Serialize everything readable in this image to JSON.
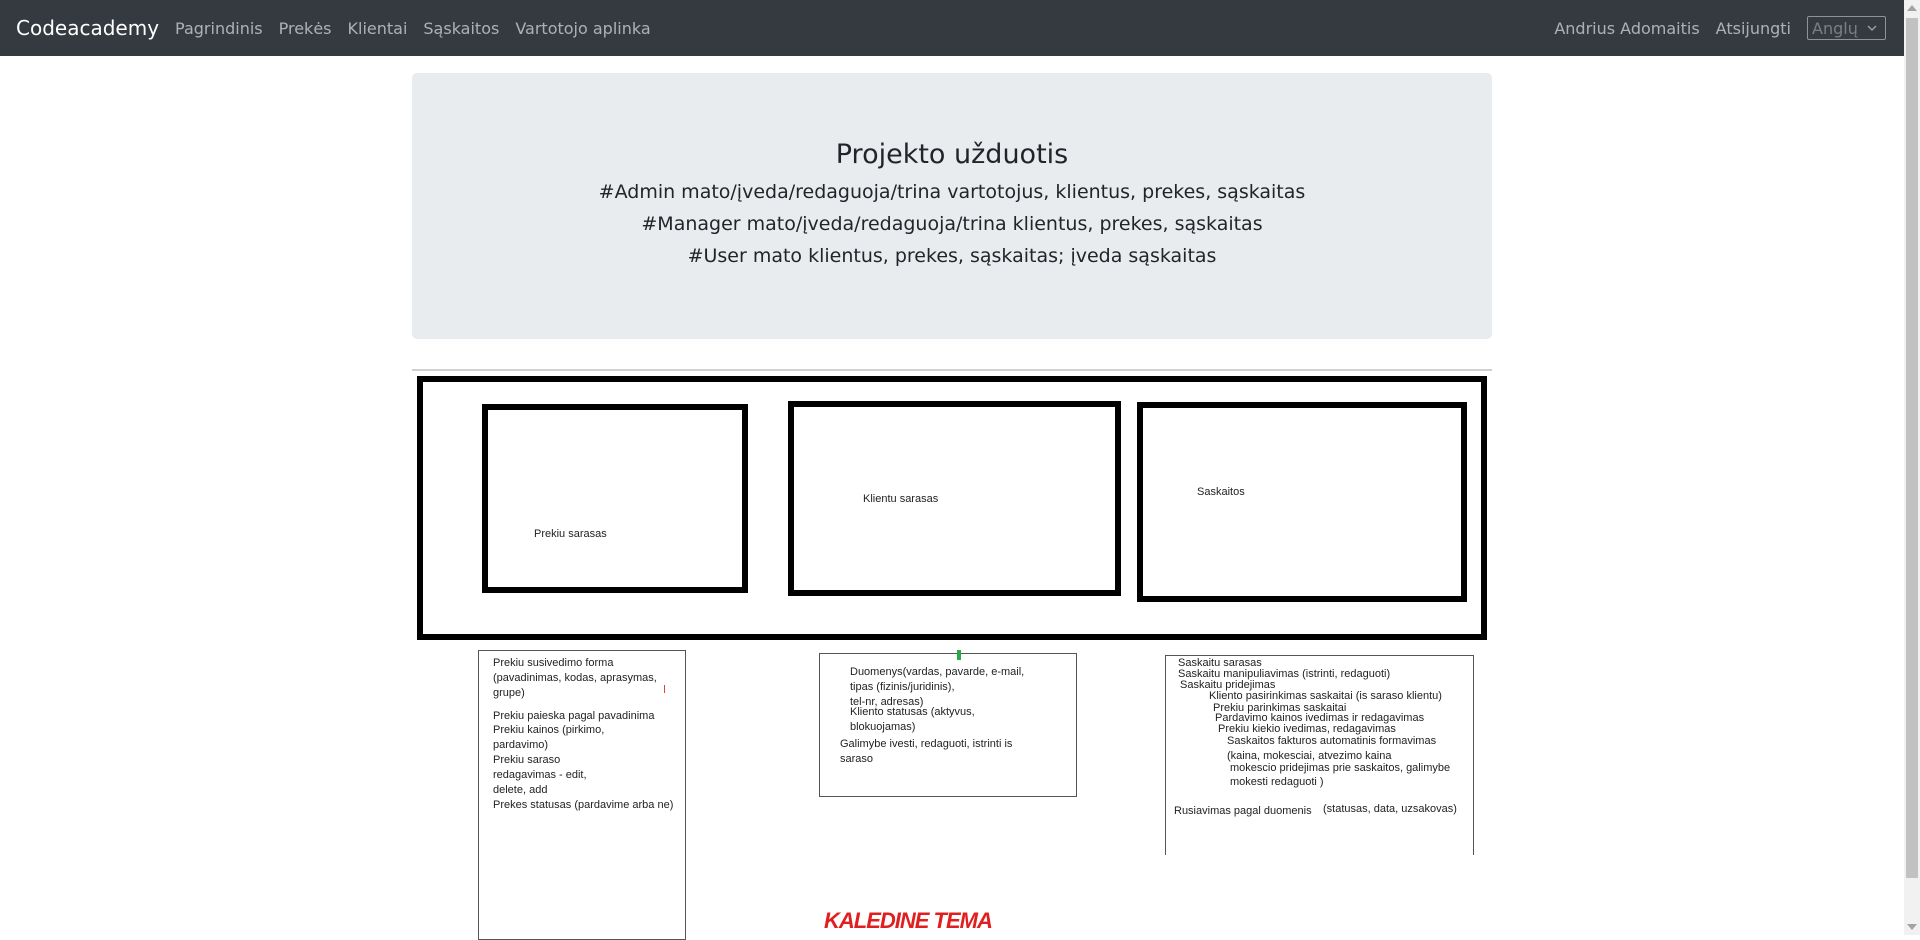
{
  "navbar": {
    "brand": "Codeacademy",
    "links": [
      "Pagrindinis",
      "Prekės",
      "Klientai",
      "Sąskaitos",
      "Vartotojo aplinka"
    ],
    "user_name": "Andrius Adomaitis",
    "logout": "Atsijungti",
    "language_selected": "Anglų",
    "background_color": "#343a40"
  },
  "jumbotron": {
    "title": "Projekto užduotis",
    "lines": [
      "#Admin mato/įveda/redaguoja/trina vartotojus, klientus, prekes, sąskaitas",
      "#Manager mato/įveda/redaguoja/trina klientus, prekes, sąskaitas",
      "#User mato klientus, prekes, sąskaitas; įveda sąskaitas"
    ],
    "background_color": "#e9ecef"
  },
  "diagram": {
    "boxes": [
      "Prekiu sarasas",
      "Klientu sarasas",
      "Saskaitos"
    ],
    "notes": {
      "prekes": [
        "Prekiu susivedimo forma",
        "(pavadinimas, kodas, aprasymas,",
        "grupe)",
        "Prekiu paieska pagal pavadinima",
        "Prekiu kainos (pirkimo,",
        "pardavimo)",
        "Prekiu saraso",
        "redagavimas - edit,",
        "delete, add",
        "Prekes statusas (pardavime arba ne)"
      ],
      "klientai": [
        "Duomenys(vardas, pavarde, e-mail,",
        "tipas (fizinis/juridinis),",
        " tel-nr, adresas)",
        "Kliento statusas (aktyvus,",
        "blokuojamas)",
        "Galimybe ivesti, redaguoti, istrinti is",
        "saraso"
      ],
      "saskaitos": [
        "Saskaitu sarasas",
        "Saskaitu manipuliavimas (istrinti, redaguoti)",
        "Saskaitu pridejimas",
        "Kliento pasirinkimas saskaitai (is saraso klientu)",
        "Prekiu parinkimas saskaitai",
        "Pardavimo kainos ivedimas ir redagavimas",
        "Prekiu kiekio ivedimas, redagavimas",
        "Saskaitos fakturos automatinis formavimas",
        "(kaina, mokesciai, atvezimo kaina",
        "mokescio pridejimas prie saskaitos, galimybe",
        "mokesti redaguoti )",
        "Rusiavimas pagal duomenis",
        "(statusas, data, uzsakovas)"
      ]
    },
    "theme_label": "KALEDINE TEMA",
    "theme_color": "#e02020"
  }
}
